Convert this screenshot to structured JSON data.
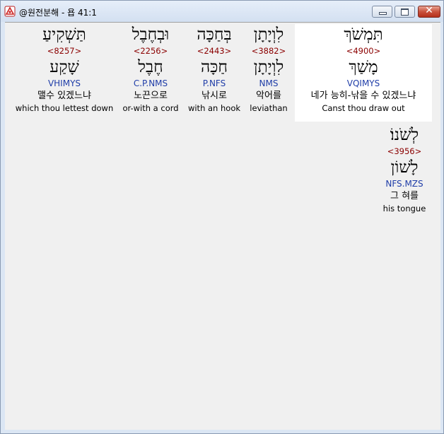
{
  "window": {
    "title": "@원전분해 - 욥 41:1"
  },
  "words": [
    {
      "surface": "תִּמְשֹׁךְ",
      "strong": "<4900>",
      "lemma": "מָשַׁךְ",
      "morph": "VQIMYS",
      "korean": "네가 능히-낚을 수 있겠느냐",
      "english": "Canst thou draw out",
      "selected": true
    },
    {
      "surface": "לִוְיָתָן",
      "strong": "<3882>",
      "lemma": "לִוְיָתָן",
      "morph": "NMS",
      "korean": "악어를",
      "english": "leviathan"
    },
    {
      "surface": "בְּחַכָּה",
      "strong": "<2443>",
      "lemma": "חַכָּה",
      "morph": "P.NFS",
      "korean": "낚시로",
      "english": "with an hook"
    },
    {
      "surface": "וּבְחֶבֶל",
      "strong": "<2256>",
      "lemma": "חֶבֶל",
      "morph": "C.P.NMS",
      "korean": "노끈으로",
      "english": "or-with a cord"
    },
    {
      "surface": "תַּשְׁקִיעַ",
      "strong": "<8257>",
      "lemma": "שָׁקַע",
      "morph": "VHIMYS",
      "korean": "맬수 있겠느냐",
      "english": "which thou lettest down"
    },
    {
      "surface": "לְשֹׁנוֹ׃",
      "strong": "<3956>",
      "lemma": "לָשׁוֹן",
      "morph": "NFS.MZS",
      "korean": "그 혀를",
      "english": "his tongue"
    }
  ]
}
